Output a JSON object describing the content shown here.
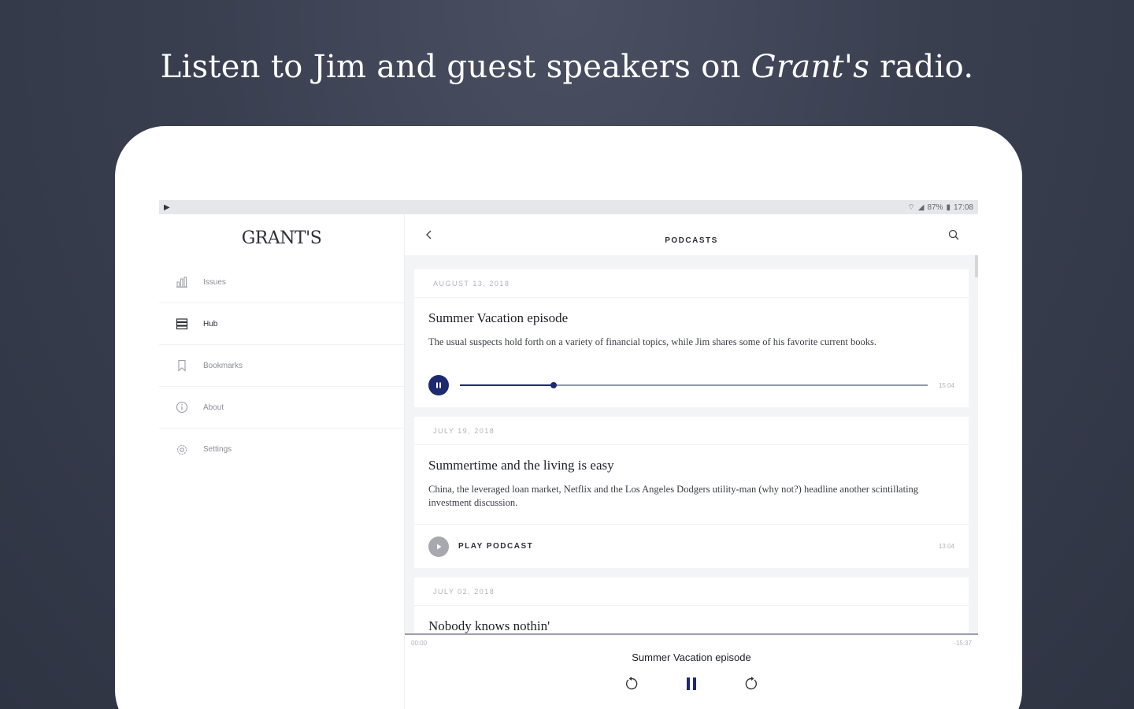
{
  "headline": {
    "prefix": "Listen to Jim and guest speakers on ",
    "brand": "Grant's",
    "suffix": " radio."
  },
  "statusbar": {
    "left_icon": "play-indicator-icon",
    "battery": "87%",
    "time": "17:08"
  },
  "sidebar": {
    "logo": "GRANT'S",
    "items": [
      {
        "label": "Issues",
        "icon": "chart-icon",
        "active": false
      },
      {
        "label": "Hub",
        "icon": "hub-icon",
        "active": true
      },
      {
        "label": "Bookmarks",
        "icon": "bookmark-icon",
        "active": false
      },
      {
        "label": "About",
        "icon": "info-icon",
        "active": false
      },
      {
        "label": "Settings",
        "icon": "gear-icon",
        "active": false
      }
    ]
  },
  "topbar": {
    "title": "PODCASTS"
  },
  "cards": [
    {
      "date": "AUGUST 13, 2018",
      "title": "Summer Vacation episode",
      "description": "The usual suspects hold forth on a variety of financial topics, while Jim shares some of his favorite current books.",
      "state": "playing",
      "progress": 0.2,
      "duration": "15:04"
    },
    {
      "date": "JULY 19, 2018",
      "title": "Summertime and the living is easy",
      "description": "China, the leveraged loan market, Netflix and the Los Angeles Dodgers utility-man (why not?) headline another scintillating investment discussion.",
      "state": "idle",
      "play_label": "PLAY PODCAST",
      "duration": "13:04"
    },
    {
      "date": "JULY 02, 2018",
      "title": "Nobody knows nothin'"
    }
  ],
  "nowplaying": {
    "elapsed": "00:00",
    "remaining": "-15:37",
    "title": "Summer Vacation episode"
  },
  "colors": {
    "accent": "#1e2a6e",
    "background": "#3a3f50"
  }
}
